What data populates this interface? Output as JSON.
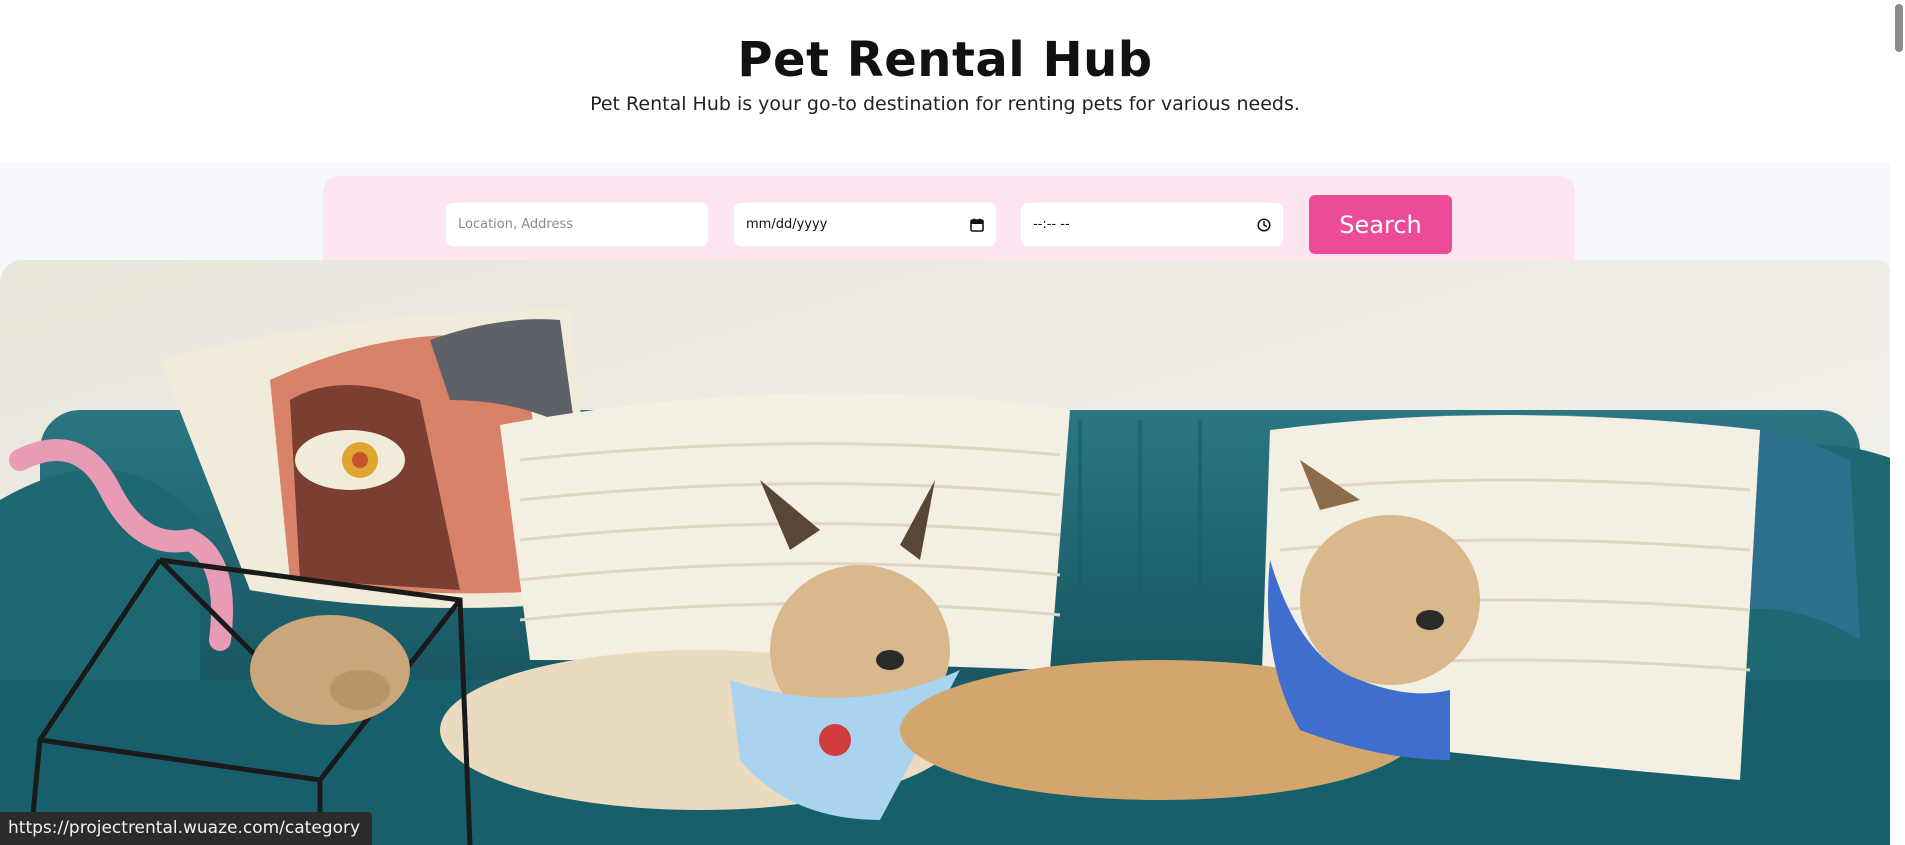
{
  "header": {
    "title": "Pet Rental Hub",
    "description": "Pet Rental Hub is your go-to destination for renting pets for various needs."
  },
  "search": {
    "location_placeholder": "Location, Address",
    "date_value": "mm/dd/yyyy",
    "time_value": "--:-- --",
    "button_label": "Search"
  },
  "hero": {
    "alt": "Two small dogs wearing bandanas lying on a teal velvet sofa with cushions"
  },
  "status_bar": {
    "url": "https://projectrental.wuaze.com/category"
  },
  "colors": {
    "accent": "#ec4b97",
    "panel": "#fde4f1",
    "sofa": "#1f6e7a"
  }
}
